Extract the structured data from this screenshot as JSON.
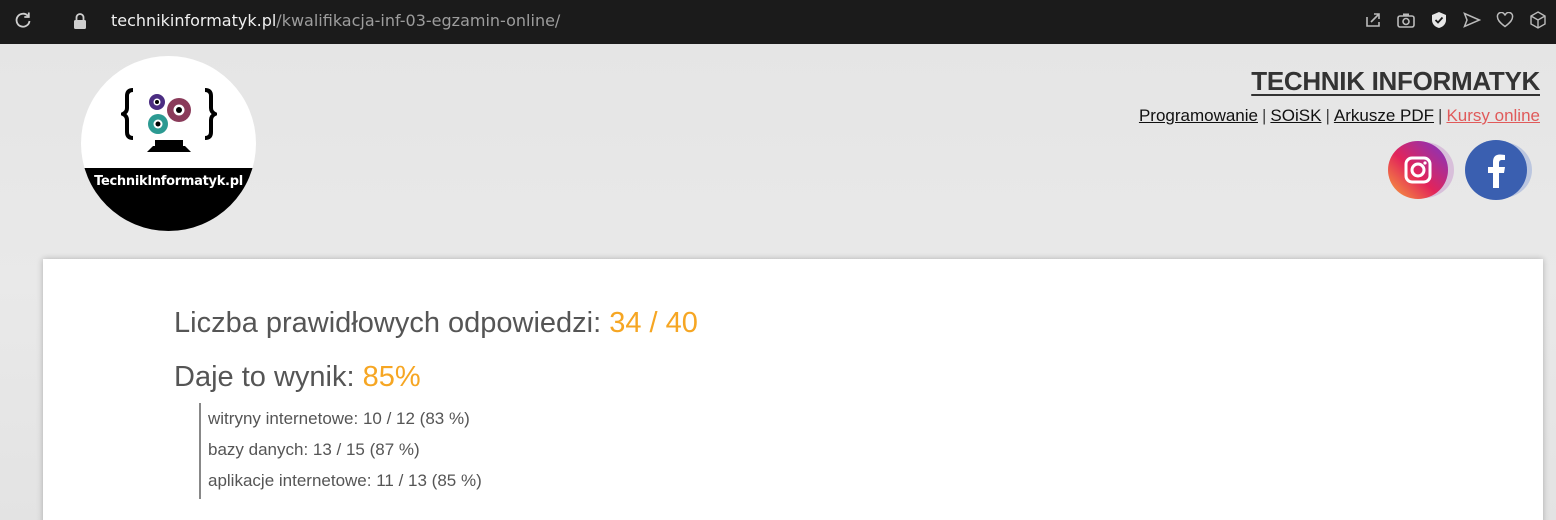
{
  "browser": {
    "url_host": "technikinformatyk.pl",
    "url_path": "/kwalifikacja-inf-03-egzamin-online/",
    "icons": [
      "reload-icon",
      "lock-icon",
      "share-icon",
      "camera-icon",
      "shield-icon",
      "send-icon",
      "heart-icon",
      "cube-icon"
    ]
  },
  "header": {
    "logo_text": "TechnikInformatyk.pl",
    "site_title": "TECHNIK INFORMATYK",
    "nav": [
      {
        "label": "Programowanie"
      },
      {
        "label": "SOiSK"
      },
      {
        "label": "Arkusze PDF"
      },
      {
        "label": "Kursy online"
      }
    ],
    "nav_separator": "|",
    "social": [
      "instagram-icon",
      "facebook-icon"
    ]
  },
  "result": {
    "correct_label": "Liczba prawidłowych odpowiedzi:",
    "correct_value": "34 / 40",
    "score_label": "Daje to wynik:",
    "score_value": "85%",
    "breakdown": [
      "witryny internetowe: 10 / 12 (83 %)",
      "bazy danych: 13 / 15 (87 %)",
      "aplikacje internetowe: 11 / 13 (85 %)"
    ]
  },
  "colors": {
    "accent_orange": "#f6a623",
    "accent_link": "#e05a5a",
    "topbar": "#1b1b1b"
  }
}
